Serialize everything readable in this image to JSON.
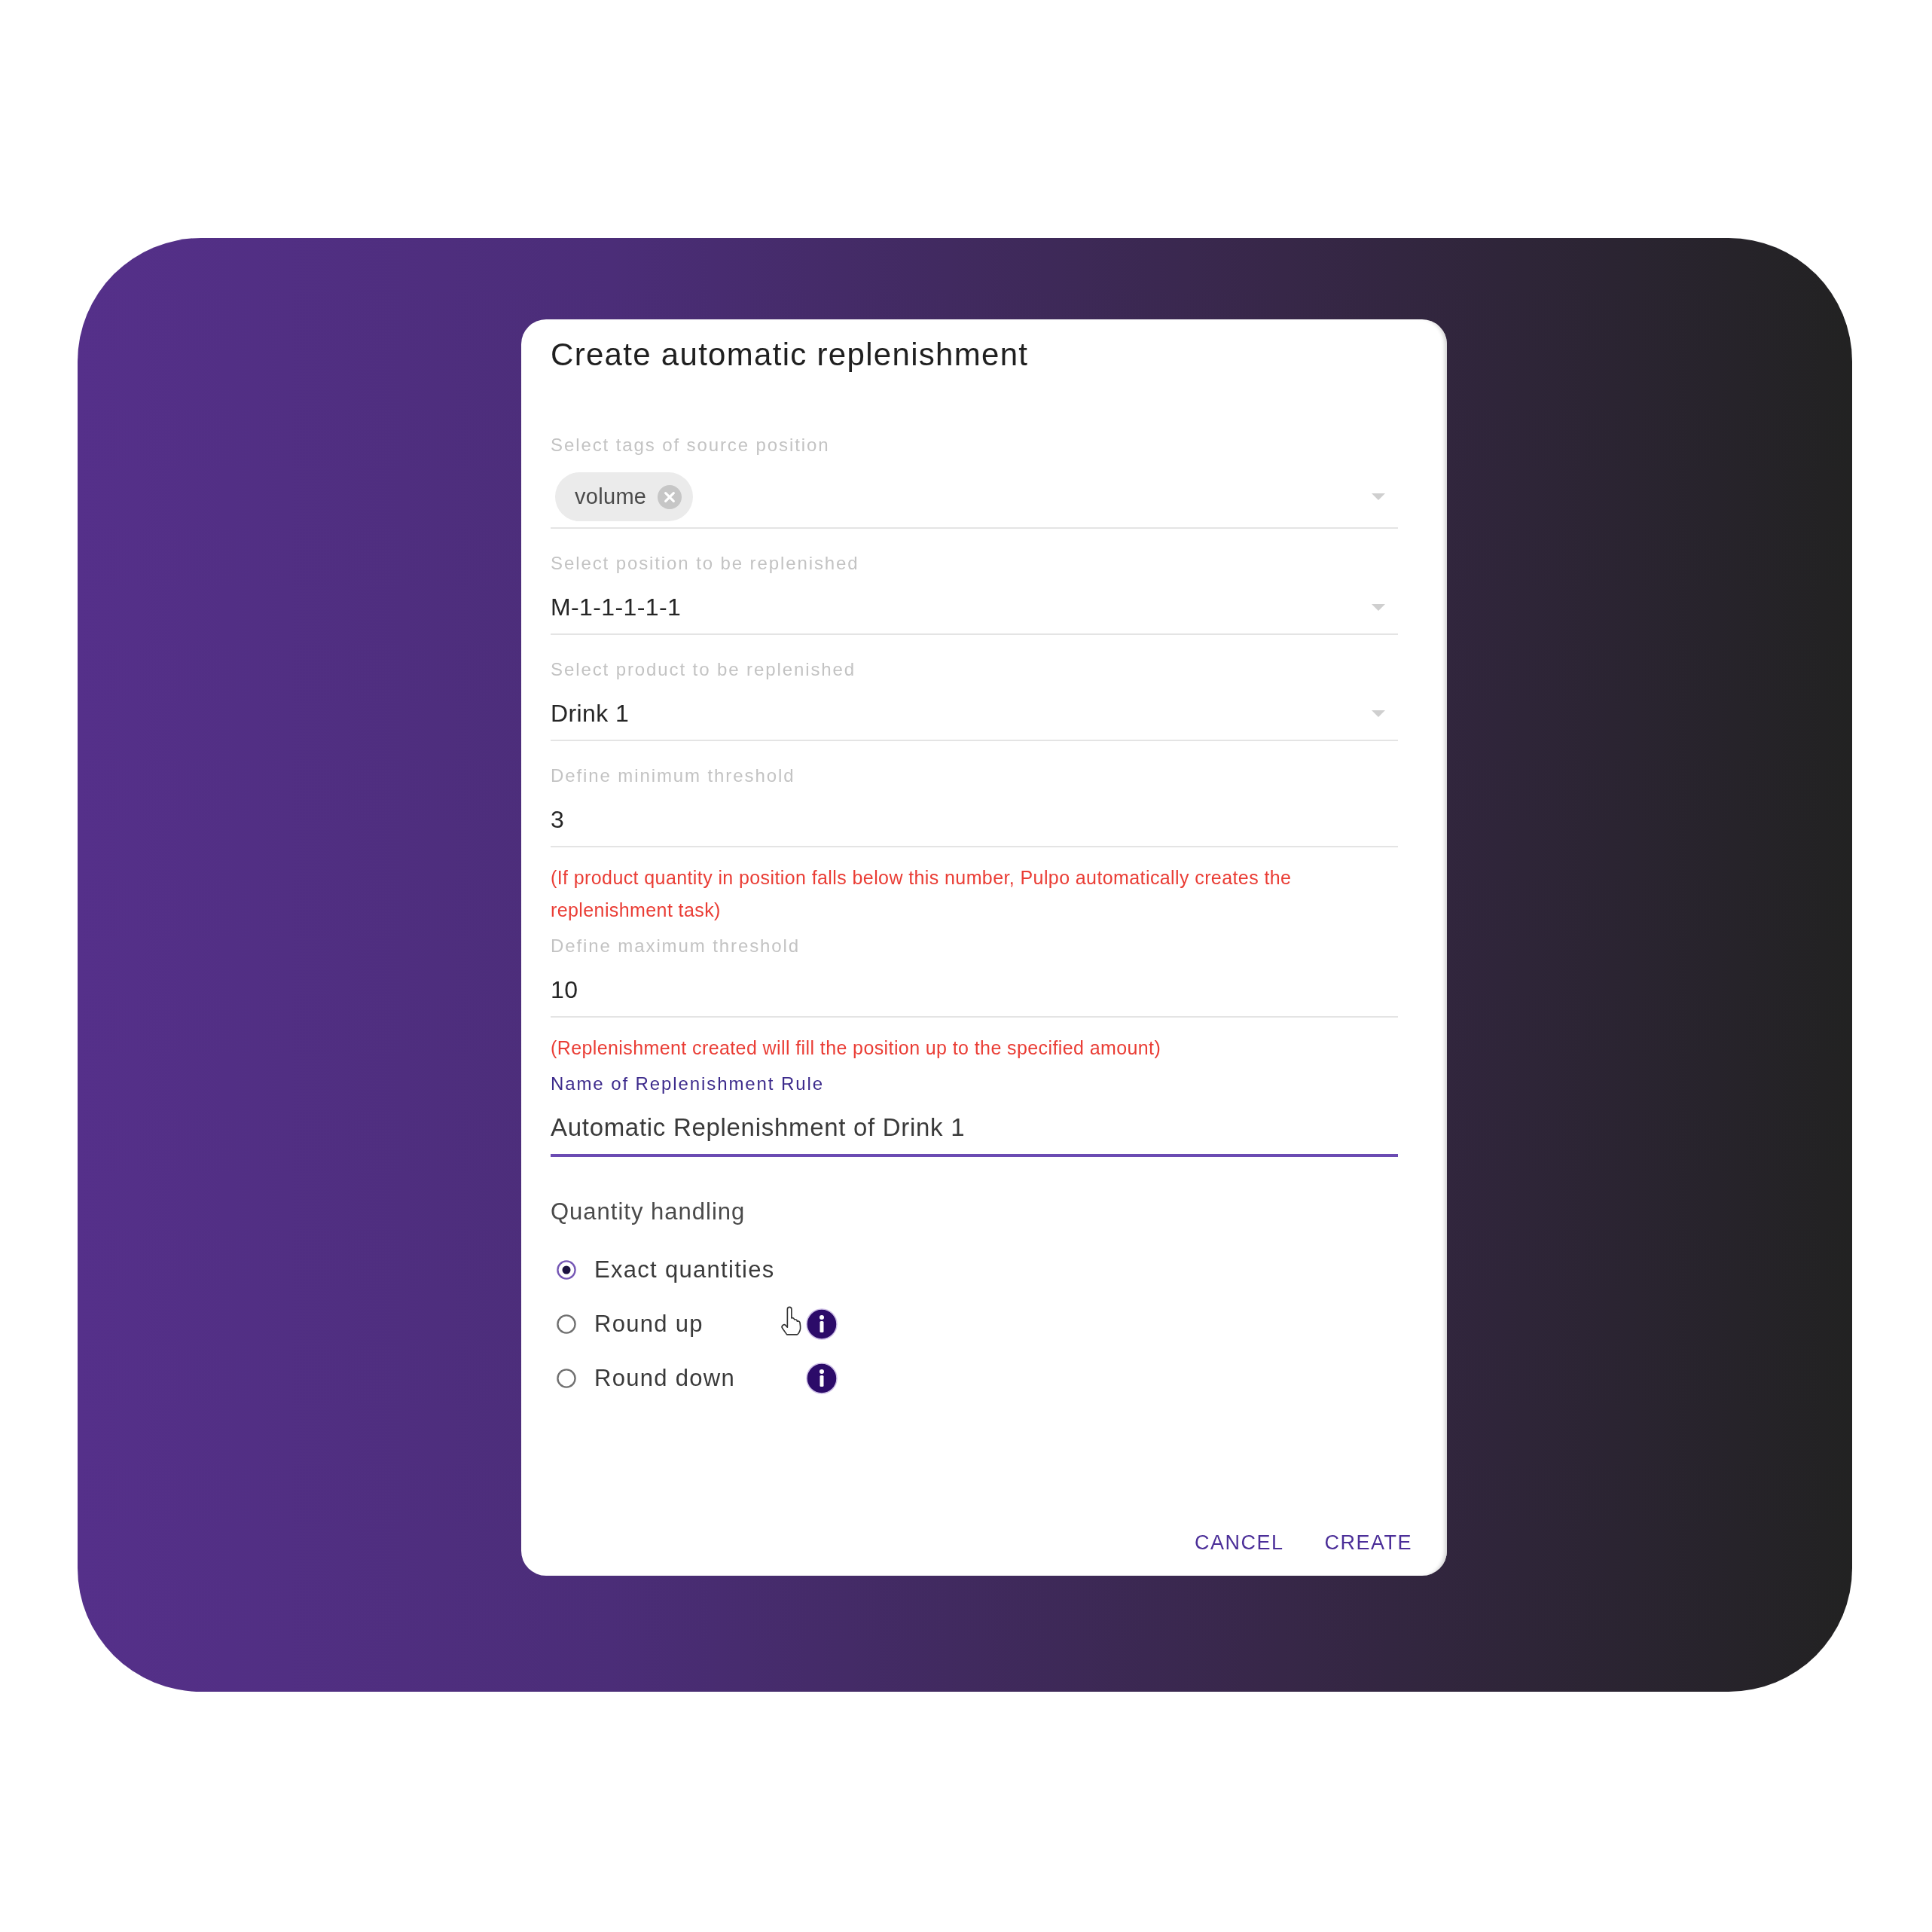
{
  "dialog": {
    "title": "Create automatic replenishment"
  },
  "fields": [
    {
      "kind": "chips",
      "label": "Select tags of source position",
      "chips": [
        {
          "label": "volume"
        }
      ],
      "focused": false
    },
    {
      "kind": "select",
      "label": "Select position to be replenished",
      "value": "M-1-1-1-1-1",
      "focused": false
    },
    {
      "kind": "select",
      "label": "Select product to be replenished",
      "value": "Drink 1",
      "focused": false
    },
    {
      "kind": "text",
      "label": "Define minimum threshold",
      "value": "3",
      "focused": false,
      "helper": "(If product quantity in position falls below this number, Pulpo automatically creates the replenishment task)"
    },
    {
      "kind": "text",
      "label": "Define maximum threshold",
      "value": "10",
      "focused": false,
      "helper": "(Replenishment created will fill the position up to the specified amount)"
    },
    {
      "kind": "text",
      "label": "Name of Replenishment Rule",
      "value": "Automatic Replenishment of Drink 1",
      "focused": true
    }
  ],
  "quantity_handling": {
    "title": "Quantity handling",
    "options": [
      {
        "label": "Exact quantities",
        "selected": true,
        "info": false,
        "hovered": false
      },
      {
        "label": "Round up",
        "selected": false,
        "info": true,
        "hovered": true
      },
      {
        "label": "Round down",
        "selected": false,
        "info": true,
        "hovered": false
      }
    ]
  },
  "actions": [
    "CANCEL",
    "CREATE"
  ]
}
